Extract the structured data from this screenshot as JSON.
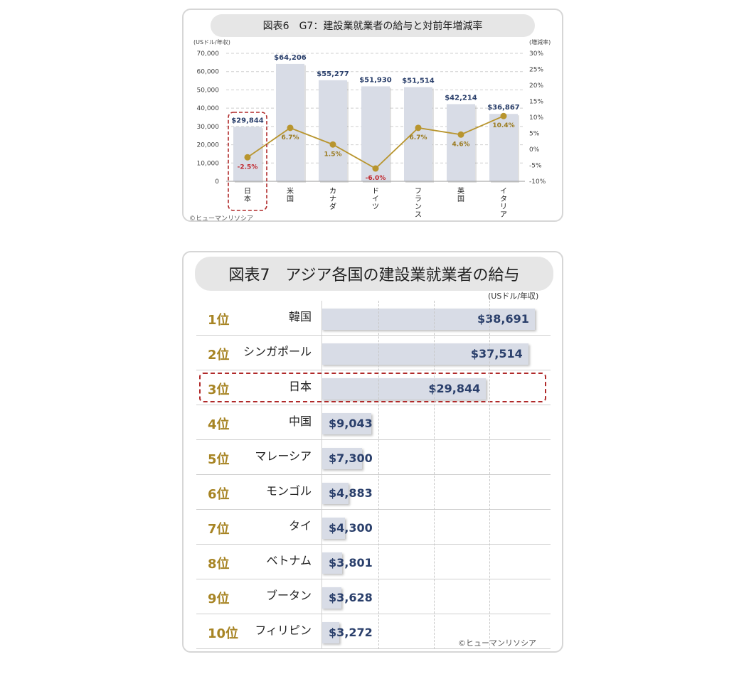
{
  "chart_data": [
    {
      "type": "bar",
      "title": "図表6　G7：建設業就業者の給与と対前年増減率",
      "ylabel": "(USドル/年収)",
      "y2label": "(増減率)",
      "ylim": [
        0,
        70000
      ],
      "y2lim": [
        -10,
        30
      ],
      "yticks": [
        "70,000",
        "60,000",
        "50,000",
        "40,000",
        "30,000",
        "20,000",
        "10,000",
        "0"
      ],
      "y2ticks": [
        "30%",
        "25%",
        "20%",
        "15%",
        "10%",
        "5%",
        "0%",
        "-5%",
        "-10%"
      ],
      "categories": [
        "日本",
        "米国",
        "カナダ",
        "ドイツ",
        "フランス",
        "英国",
        "イタリア"
      ],
      "series": [
        {
          "type": "bar",
          "values": [
            29844,
            64206,
            55277,
            51930,
            51514,
            42214,
            36867
          ],
          "labels": [
            "$29,844",
            "$64,206",
            "$55,277",
            "$51,930",
            "$51,514",
            "$42,214",
            "$36,867"
          ]
        },
        {
          "type": "line",
          "axis": "right",
          "values": [
            -2.5,
            6.7,
            1.5,
            -6.0,
            6.7,
            4.6,
            10.4
          ],
          "labels": [
            "-2.5%",
            "6.7%",
            "1.5%",
            "-6.0%",
            "6.7%",
            "4.6%",
            "10.4%"
          ]
        }
      ],
      "highlight_category": "日本",
      "grid": true,
      "colors": {
        "bar": "#d8dce6",
        "line": "#b8952e",
        "negative_label": "#c0272d",
        "positive_label": "#9a7a1e",
        "bar_label": "#2a3f6b",
        "highlight": "#b02a2a"
      },
      "copyright": "©ヒューマンリソシア"
    },
    {
      "type": "bar",
      "orientation": "horizontal",
      "title": "図表7　アジア各国の建設業就業者の給与",
      "unit": "(USドル/年収)",
      "categories": [
        "韓国",
        "シンガポール",
        "日本",
        "中国",
        "マレーシア",
        "モンゴル",
        "タイ",
        "ベトナム",
        "ブータン",
        "フィリピン"
      ],
      "ranks": [
        "1位",
        "2位",
        "3位",
        "4位",
        "5位",
        "6位",
        "7位",
        "8位",
        "9位",
        "10位"
      ],
      "values": [
        38691,
        37514,
        29844,
        9043,
        7300,
        4883,
        4300,
        3801,
        3628,
        3272
      ],
      "labels": [
        "$38,691",
        "$37,514",
        "$29,844",
        "$9,043",
        "$7,300",
        "$4,883",
        "$4,300",
        "$3,801",
        "$3,628",
        "$3,272"
      ],
      "xlim": [
        0,
        40000
      ],
      "highlight_category": "日本",
      "colors": {
        "bar": "#d8dce6",
        "rank": "#a78424",
        "label": "#2a3f6b",
        "highlight": "#b02a2a"
      },
      "copyright": "©ヒューマンリソシア"
    }
  ]
}
